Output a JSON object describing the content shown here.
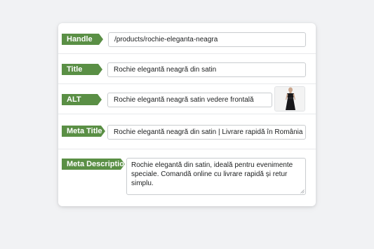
{
  "fields": {
    "handle": {
      "label": "Handle",
      "value": "/products/rochie-eleganta-neagra"
    },
    "title": {
      "label": "Title",
      "value": "Rochie elegantă neagră din satin"
    },
    "alt": {
      "label": "ALT",
      "value": "Rochie elegantă neagră satin vedere frontală",
      "thumbnail_icon": "black-dress-thumbnail"
    },
    "meta_title": {
      "label": "Meta Title",
      "value": "Rochie elegantă neagră din satin | Livrare rapidă în România"
    },
    "meta_description": {
      "label": "Meta Description",
      "value": "Rochie elegantă din satin, ideală pentru evenimente speciale. Comandă online cu livrare rapidă și retur simplu."
    }
  },
  "colors": {
    "label_green": "#5a8f45",
    "page_background": "#f1f2f4",
    "card_background": "#ffffff",
    "input_border": "#c9cccf"
  }
}
